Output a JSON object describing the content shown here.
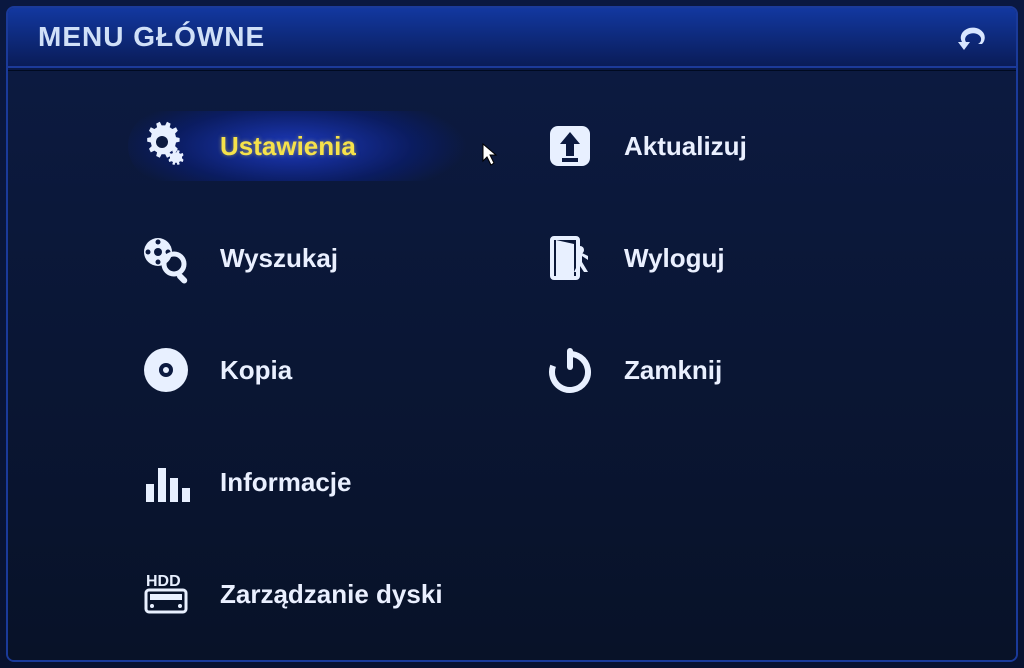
{
  "title": "MENU GŁÓWNE",
  "items": {
    "settings": {
      "label": "Ustawienia"
    },
    "search": {
      "label": "Wyszukaj"
    },
    "copy": {
      "label": "Kopia"
    },
    "info": {
      "label": "Informacje"
    },
    "diskmgmt": {
      "label": "Zarządzanie dyski"
    },
    "update": {
      "label": "Aktualizuj"
    },
    "logout": {
      "label": "Wyloguj"
    },
    "shutdown": {
      "label": "Zamknij"
    }
  },
  "selected": "settings"
}
